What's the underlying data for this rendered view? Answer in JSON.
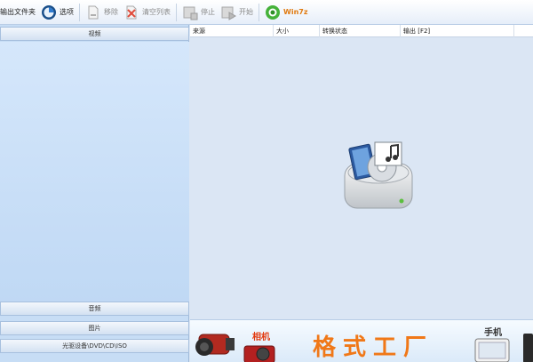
{
  "toolbar": {
    "output_folder": "输出文件夹",
    "options": "选项",
    "remove": "移除",
    "clear_list": "清空列表",
    "stop": "停止",
    "start": "开始",
    "win7z": "Win7z"
  },
  "sidebar": {
    "categories": [
      "视频",
      "音频",
      "图片",
      "光驱设备\\DVD\\CD\\ISO"
    ]
  },
  "file_list": {
    "columns": [
      "来源",
      "大小",
      "转换状态",
      "输出 [F2]"
    ]
  },
  "banner": {
    "camera_label": "相机",
    "brand": "格式工厂",
    "phone_label": "手机"
  },
  "colors": {
    "brand": "#f07818",
    "panel_bg": "#c7ddf5",
    "content_bg": "#dbe6f4"
  }
}
